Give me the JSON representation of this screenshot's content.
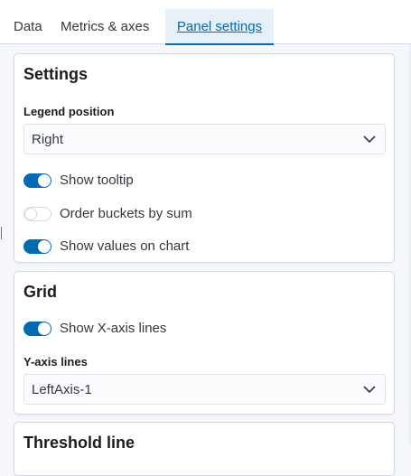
{
  "tabs": [
    {
      "label": "Data"
    },
    {
      "label": "Metrics & axes"
    },
    {
      "label": "Panel settings",
      "active": true
    }
  ],
  "settings": {
    "title": "Settings",
    "legend_position_label": "Legend position",
    "legend_position_value": "Right",
    "toggles": [
      {
        "label": "Show tooltip",
        "checked": true
      },
      {
        "label": "Order buckets by sum",
        "checked": false
      },
      {
        "label": "Show values on chart",
        "checked": true
      }
    ]
  },
  "grid": {
    "title": "Grid",
    "x_axis_toggle": {
      "label": "Show X-axis lines",
      "checked": true
    },
    "y_axis_lines_label": "Y-axis lines",
    "y_axis_lines_value": "LeftAxis-1"
  },
  "threshold": {
    "title": "Threshold line"
  },
  "colors": {
    "accent": "#006bb4",
    "tab_active_bg": "#e6f0f8",
    "border": "#d3dae6"
  }
}
